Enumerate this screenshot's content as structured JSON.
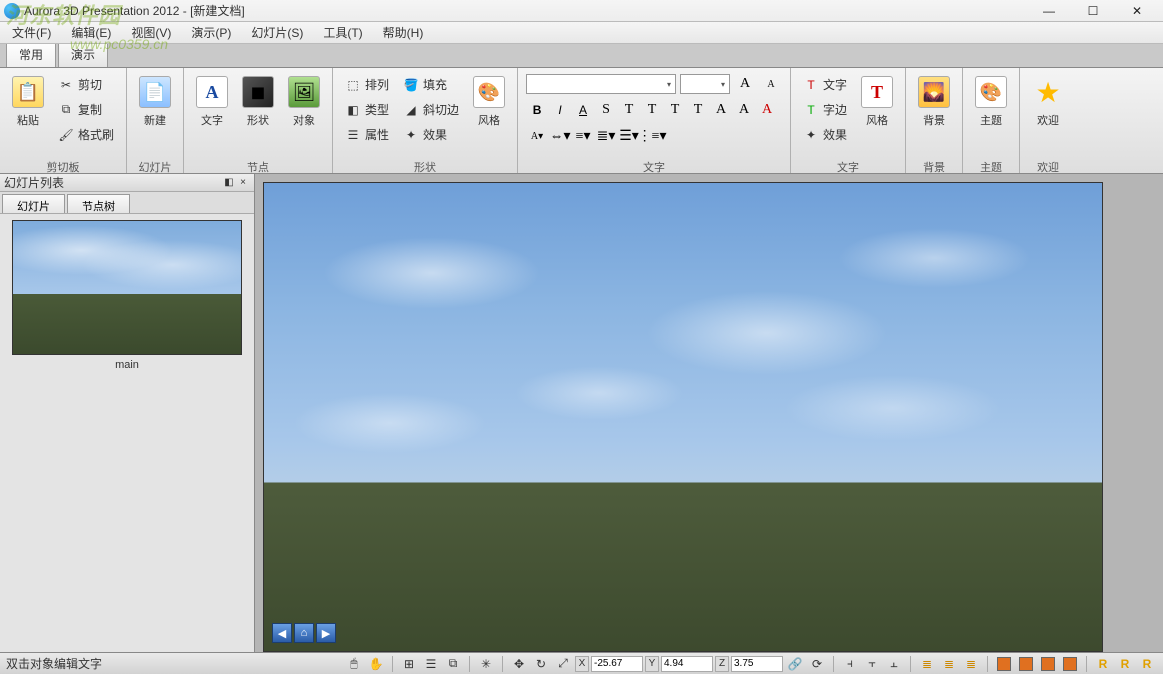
{
  "title": "Aurora 3D Presentation 2012 - [新建文档]",
  "watermark": {
    "main": "河东软件园",
    "sub": "www.pc0359.cn"
  },
  "menu": {
    "file": "文件(F)",
    "edit": "编辑(E)",
    "view": "视图(V)",
    "present": "演示(P)",
    "slide": "幻灯片(S)",
    "tools": "工具(T)",
    "help": "帮助(H)"
  },
  "tabs": {
    "common": "常用",
    "present": "演示"
  },
  "ribbon": {
    "clipboard": {
      "label": "剪切板",
      "paste": "粘贴",
      "cut": "剪切",
      "copy": "复制",
      "format": "格式刷"
    },
    "slide": {
      "label": "幻灯片",
      "new": "新建"
    },
    "node": {
      "label": "节点",
      "text": "文字",
      "shape": "形状",
      "object": "对象"
    },
    "shape": {
      "label": "形状",
      "arrange": "排列",
      "type": "类型",
      "prop": "属性",
      "fill": "填充",
      "bevel": "斜切边",
      "effect": "效果",
      "style": "风格"
    },
    "font": {
      "label": "文字",
      "family": "",
      "size": ""
    },
    "textfx": {
      "label": "文字",
      "text": "文字",
      "border": "字边",
      "effect": "效果",
      "style": "风格"
    },
    "bg": {
      "label": "背景"
    },
    "theme": {
      "label": "主题"
    },
    "welcome": {
      "label": "欢迎"
    }
  },
  "side": {
    "title": "幻灯片列表",
    "tab1": "幻灯片",
    "tab2": "节点树",
    "thumb": "main"
  },
  "status": {
    "hint": "双击对象编辑文字",
    "x": "-25.67",
    "y": "4.94",
    "z": "3.75",
    "xl": "X",
    "yl": "Y",
    "zl": "Z"
  }
}
